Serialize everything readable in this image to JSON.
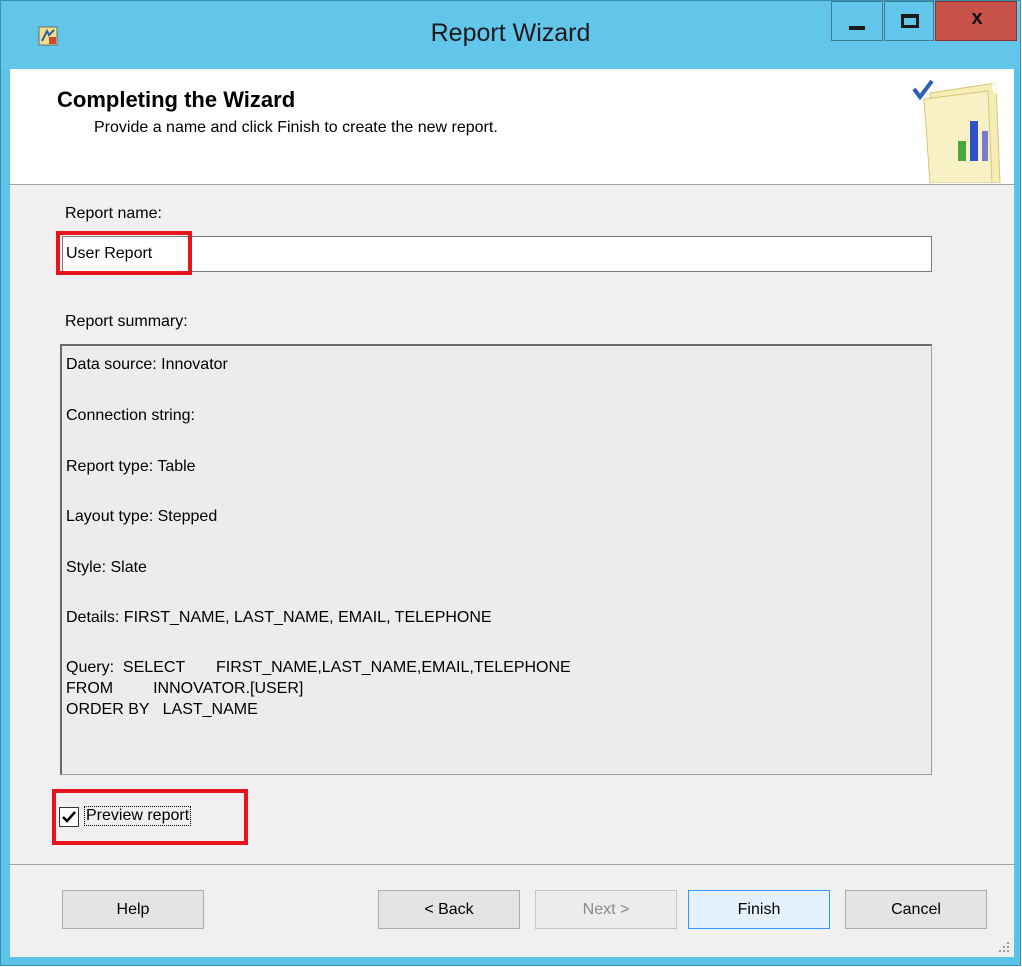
{
  "window": {
    "title": "Report Wizard",
    "close_glyph": "x"
  },
  "header": {
    "title": "Completing the Wizard",
    "subtitle": "Provide a name and click Finish to create the new report."
  },
  "report_name": {
    "label": "Report name:",
    "value": "User Report"
  },
  "summary": {
    "label": "Report summary:",
    "lines": [
      "Data source: Innovator",
      "Connection string:",
      "Report type: Table",
      "Layout type: Stepped",
      "Style: Slate",
      "Details: FIRST_NAME, LAST_NAME, EMAIL, TELEPHONE",
      "Query:  SELECT       FIRST_NAME,LAST_NAME,EMAIL,TELEPHONE",
      "FROM         INNOVATOR.[USER]",
      "ORDER BY   LAST_NAME"
    ]
  },
  "preview": {
    "label": "Preview report",
    "checked": true
  },
  "buttons": {
    "help": "Help",
    "back": "< Back",
    "next": "Next >",
    "finish": "Finish",
    "cancel": "Cancel"
  },
  "colors": {
    "titlebar": "#61c6ea",
    "highlight": "#e8141d",
    "close": "#c7524a"
  }
}
